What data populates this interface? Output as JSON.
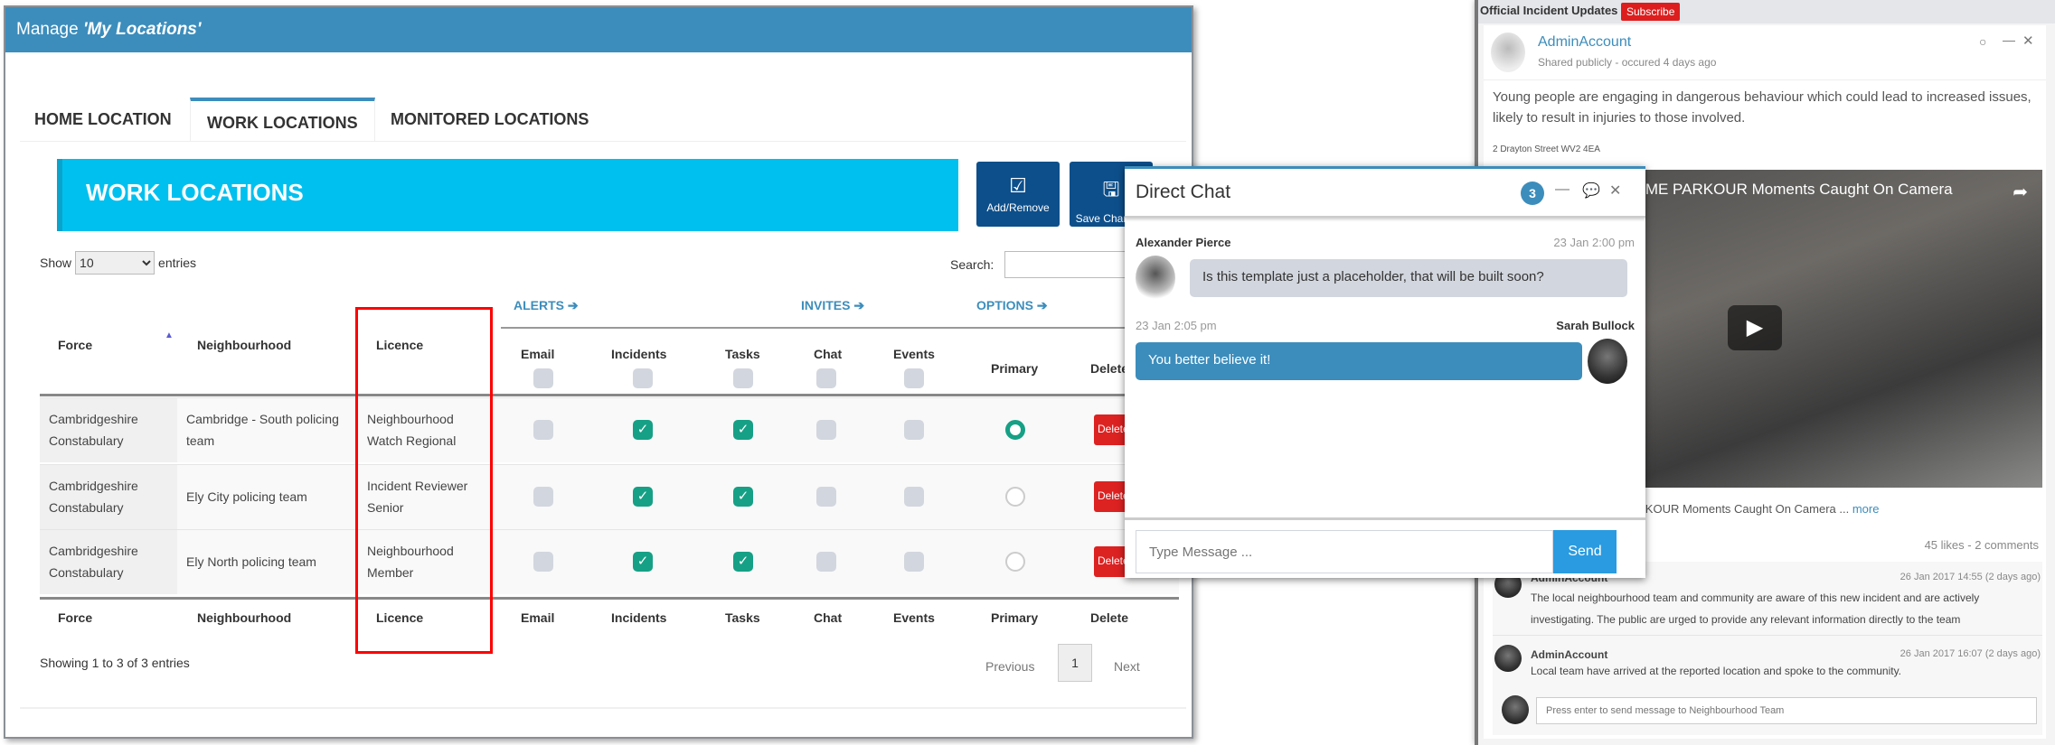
{
  "manage": {
    "title_prefix": "Manage ",
    "title_name": "'My Locations'",
    "tabs": [
      {
        "label": "HOME LOCATION"
      },
      {
        "label": "WORK LOCATIONS",
        "active": true
      },
      {
        "label": "MONITORED LOCATIONS"
      }
    ],
    "banner": "WORK LOCATIONS",
    "buttons": {
      "add_remove": "Add/Remove",
      "save": "Save Changes"
    },
    "show_label": "Show",
    "entries_value": "10",
    "entries_label": "entries",
    "search_label": "Search:",
    "search_value": "",
    "groups": {
      "alerts": "ALERTS",
      "invites": "INVITES",
      "options": "OPTIONS"
    },
    "columns": [
      "Force",
      "Neighbourhood",
      "Licence",
      "Email",
      "Incidents",
      "Tasks",
      "Chat",
      "Events",
      "Primary",
      "Delete"
    ],
    "rows": [
      {
        "force": "Cambridgeshire Constabulary",
        "neighbourhood": "Cambridge - South policing team",
        "licence": "Neighbourhood Watch Regional",
        "email": false,
        "incidents": true,
        "tasks": true,
        "chat": false,
        "events": false,
        "primary": true,
        "delete": "Delete"
      },
      {
        "force": "Cambridgeshire Constabulary",
        "neighbourhood": "Ely City policing team",
        "licence": "Incident Reviewer Senior",
        "email": false,
        "incidents": true,
        "tasks": true,
        "chat": false,
        "events": false,
        "primary": false,
        "delete": "Delete"
      },
      {
        "force": "Cambridgeshire Constabulary",
        "neighbourhood": "Ely North policing team",
        "licence": "Neighbourhood Member",
        "email": false,
        "incidents": true,
        "tasks": true,
        "chat": false,
        "events": false,
        "primary": false,
        "delete": "Delete"
      }
    ],
    "info": "Showing 1 to 3 of 3 entries",
    "pagination": {
      "previous": "Previous",
      "page": "1",
      "next": "Next"
    },
    "highlight_color": "#ff0000"
  },
  "chat": {
    "title": "Direct Chat",
    "badge": "3",
    "messages": [
      {
        "name": "Alexander Pierce",
        "time": "23 Jan 2:00 pm",
        "text": "Is this template just a placeholder, that will be built soon?"
      },
      {
        "name": "Sarah Bullock",
        "time": "23 Jan 2:05 pm",
        "text": "You better believe it!"
      }
    ],
    "placeholder": "Type Message ...",
    "send": "Send"
  },
  "feed": {
    "header": "Official Incident Updates",
    "subscribe": "Subscribe",
    "user": "AdminAccount",
    "meta": "Shared publicly - occured 4 days ago",
    "text": "Young people are engaging in dangerous behaviour which could lead to increased issues, likely to result in injuries to those involved.",
    "address": "2 Drayton Street WV2 4EA",
    "video_title": "The Scariest EXTREME PARKOUR Moments Caught On Camera",
    "caption": "The Scariest EXTREME PARKOUR Moments Caught On Camera ...",
    "more": "more",
    "stats": "45 likes - 2 comments",
    "comments": [
      {
        "user": "AdminAccount",
        "time": "26 Jan 2017 14:55 (2 days ago)",
        "text": "The local neighbourhood team and community are aware of this new incident and are actively investigating. The public are urged to provide any relevant information directly to the team"
      },
      {
        "user": "AdminAccount",
        "time": "26 Jan 2017 16:07 (2 days ago)",
        "text": "Local team have arrived at the reported location and spoke to the community."
      }
    ],
    "comment_placeholder": "Press enter to send message to Neighbourhood Team"
  }
}
